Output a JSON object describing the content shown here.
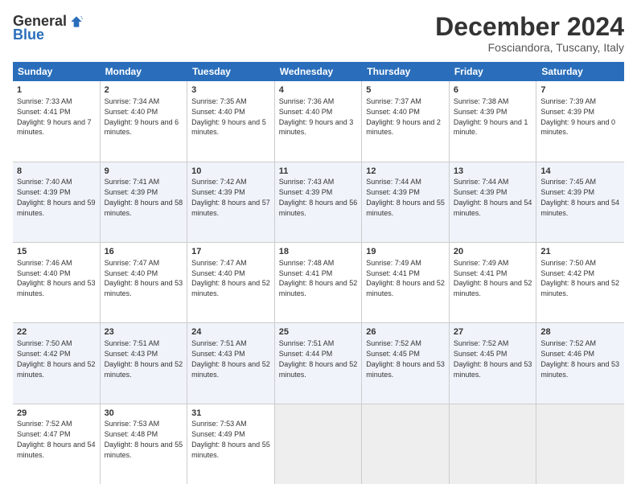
{
  "logo": {
    "general": "General",
    "blue": "Blue"
  },
  "title": "December 2024",
  "location": "Fosciandora, Tuscany, Italy",
  "headers": [
    "Sunday",
    "Monday",
    "Tuesday",
    "Wednesday",
    "Thursday",
    "Friday",
    "Saturday"
  ],
  "rows": [
    [
      {
        "day": "1",
        "sunrise": "Sunrise: 7:33 AM",
        "sunset": "Sunset: 4:41 PM",
        "daylight": "Daylight: 9 hours and 7 minutes."
      },
      {
        "day": "2",
        "sunrise": "Sunrise: 7:34 AM",
        "sunset": "Sunset: 4:40 PM",
        "daylight": "Daylight: 9 hours and 6 minutes."
      },
      {
        "day": "3",
        "sunrise": "Sunrise: 7:35 AM",
        "sunset": "Sunset: 4:40 PM",
        "daylight": "Daylight: 9 hours and 5 minutes."
      },
      {
        "day": "4",
        "sunrise": "Sunrise: 7:36 AM",
        "sunset": "Sunset: 4:40 PM",
        "daylight": "Daylight: 9 hours and 3 minutes."
      },
      {
        "day": "5",
        "sunrise": "Sunrise: 7:37 AM",
        "sunset": "Sunset: 4:40 PM",
        "daylight": "Daylight: 9 hours and 2 minutes."
      },
      {
        "day": "6",
        "sunrise": "Sunrise: 7:38 AM",
        "sunset": "Sunset: 4:39 PM",
        "daylight": "Daylight: 9 hours and 1 minute."
      },
      {
        "day": "7",
        "sunrise": "Sunrise: 7:39 AM",
        "sunset": "Sunset: 4:39 PM",
        "daylight": "Daylight: 9 hours and 0 minutes."
      }
    ],
    [
      {
        "day": "8",
        "sunrise": "Sunrise: 7:40 AM",
        "sunset": "Sunset: 4:39 PM",
        "daylight": "Daylight: 8 hours and 59 minutes."
      },
      {
        "day": "9",
        "sunrise": "Sunrise: 7:41 AM",
        "sunset": "Sunset: 4:39 PM",
        "daylight": "Daylight: 8 hours and 58 minutes."
      },
      {
        "day": "10",
        "sunrise": "Sunrise: 7:42 AM",
        "sunset": "Sunset: 4:39 PM",
        "daylight": "Daylight: 8 hours and 57 minutes."
      },
      {
        "day": "11",
        "sunrise": "Sunrise: 7:43 AM",
        "sunset": "Sunset: 4:39 PM",
        "daylight": "Daylight: 8 hours and 56 minutes."
      },
      {
        "day": "12",
        "sunrise": "Sunrise: 7:44 AM",
        "sunset": "Sunset: 4:39 PM",
        "daylight": "Daylight: 8 hours and 55 minutes."
      },
      {
        "day": "13",
        "sunrise": "Sunrise: 7:44 AM",
        "sunset": "Sunset: 4:39 PM",
        "daylight": "Daylight: 8 hours and 54 minutes."
      },
      {
        "day": "14",
        "sunrise": "Sunrise: 7:45 AM",
        "sunset": "Sunset: 4:39 PM",
        "daylight": "Daylight: 8 hours and 54 minutes."
      }
    ],
    [
      {
        "day": "15",
        "sunrise": "Sunrise: 7:46 AM",
        "sunset": "Sunset: 4:40 PM",
        "daylight": "Daylight: 8 hours and 53 minutes."
      },
      {
        "day": "16",
        "sunrise": "Sunrise: 7:47 AM",
        "sunset": "Sunset: 4:40 PM",
        "daylight": "Daylight: 8 hours and 53 minutes."
      },
      {
        "day": "17",
        "sunrise": "Sunrise: 7:47 AM",
        "sunset": "Sunset: 4:40 PM",
        "daylight": "Daylight: 8 hours and 52 minutes."
      },
      {
        "day": "18",
        "sunrise": "Sunrise: 7:48 AM",
        "sunset": "Sunset: 4:41 PM",
        "daylight": "Daylight: 8 hours and 52 minutes."
      },
      {
        "day": "19",
        "sunrise": "Sunrise: 7:49 AM",
        "sunset": "Sunset: 4:41 PM",
        "daylight": "Daylight: 8 hours and 52 minutes."
      },
      {
        "day": "20",
        "sunrise": "Sunrise: 7:49 AM",
        "sunset": "Sunset: 4:41 PM",
        "daylight": "Daylight: 8 hours and 52 minutes."
      },
      {
        "day": "21",
        "sunrise": "Sunrise: 7:50 AM",
        "sunset": "Sunset: 4:42 PM",
        "daylight": "Daylight: 8 hours and 52 minutes."
      }
    ],
    [
      {
        "day": "22",
        "sunrise": "Sunrise: 7:50 AM",
        "sunset": "Sunset: 4:42 PM",
        "daylight": "Daylight: 8 hours and 52 minutes."
      },
      {
        "day": "23",
        "sunrise": "Sunrise: 7:51 AM",
        "sunset": "Sunset: 4:43 PM",
        "daylight": "Daylight: 8 hours and 52 minutes."
      },
      {
        "day": "24",
        "sunrise": "Sunrise: 7:51 AM",
        "sunset": "Sunset: 4:43 PM",
        "daylight": "Daylight: 8 hours and 52 minutes."
      },
      {
        "day": "25",
        "sunrise": "Sunrise: 7:51 AM",
        "sunset": "Sunset: 4:44 PM",
        "daylight": "Daylight: 8 hours and 52 minutes."
      },
      {
        "day": "26",
        "sunrise": "Sunrise: 7:52 AM",
        "sunset": "Sunset: 4:45 PM",
        "daylight": "Daylight: 8 hours and 53 minutes."
      },
      {
        "day": "27",
        "sunrise": "Sunrise: 7:52 AM",
        "sunset": "Sunset: 4:45 PM",
        "daylight": "Daylight: 8 hours and 53 minutes."
      },
      {
        "day": "28",
        "sunrise": "Sunrise: 7:52 AM",
        "sunset": "Sunset: 4:46 PM",
        "daylight": "Daylight: 8 hours and 53 minutes."
      }
    ],
    [
      {
        "day": "29",
        "sunrise": "Sunrise: 7:52 AM",
        "sunset": "Sunset: 4:47 PM",
        "daylight": "Daylight: 8 hours and 54 minutes."
      },
      {
        "day": "30",
        "sunrise": "Sunrise: 7:53 AM",
        "sunset": "Sunset: 4:48 PM",
        "daylight": "Daylight: 8 hours and 55 minutes."
      },
      {
        "day": "31",
        "sunrise": "Sunrise: 7:53 AM",
        "sunset": "Sunset: 4:49 PM",
        "daylight": "Daylight: 8 hours and 55 minutes."
      },
      null,
      null,
      null,
      null
    ]
  ]
}
